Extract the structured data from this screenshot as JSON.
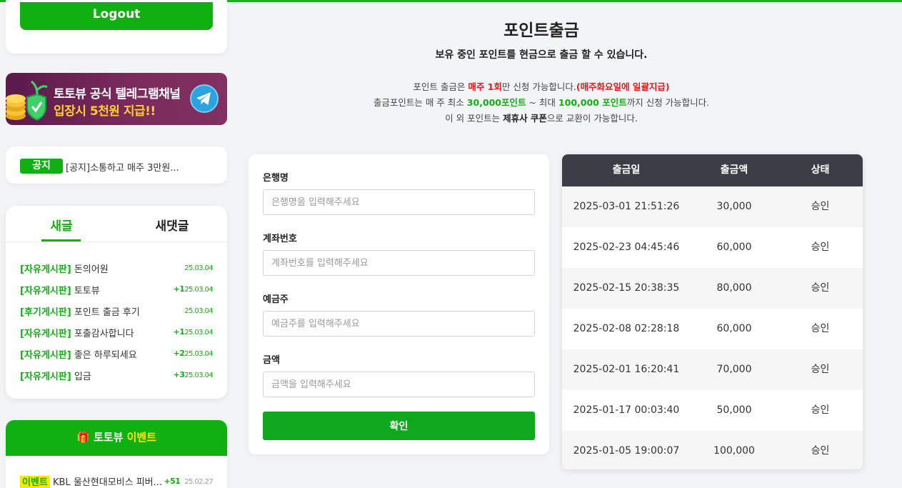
{
  "sidebar": {
    "logout_label": "Logout",
    "banner": {
      "line1": "토토뷰 공식 텔레그램채널",
      "line2": "입장시 5천원 지급!!"
    },
    "notice": {
      "badge": "공지",
      "text": "[공지]소통하고 매주 3만원..."
    },
    "posts": {
      "tabs": [
        "새글",
        "새댓글"
      ],
      "items": [
        {
          "board": "[자유게시판]",
          "title": "돈의어원",
          "count": "",
          "date": "25.03.04"
        },
        {
          "board": "[자유게시판]",
          "title": "토토뷰",
          "count": "+1",
          "date": "25.03.04"
        },
        {
          "board": "[후기게시판]",
          "title": "포인트 출금 후기",
          "count": "",
          "date": "25.03.04"
        },
        {
          "board": "[자유게시판]",
          "title": "포출감사합니다",
          "count": "+1",
          "date": "25.03.04"
        },
        {
          "board": "[자유게시판]",
          "title": "좋은 하루되세요",
          "count": "+2",
          "date": "25.03.04"
        },
        {
          "board": "[자유게시판]",
          "title": "입금",
          "count": "+3",
          "date": "25.03.04"
        }
      ]
    },
    "event": {
      "title_a": "토토뷰",
      "title_b": "이벤트",
      "items": [
        {
          "badge": "이벤트",
          "title": "KBL 울산현대모비스 피버...",
          "count": "+51",
          "date": "25.02.27"
        }
      ]
    }
  },
  "main": {
    "title": "포인트출금",
    "subtitle": "보유 중인 포인트를 현금으로 출금 할 수 있습니다.",
    "info1": {
      "a": "포인트 출금은 ",
      "b": "매주 1회",
      "c": "만 신청 가능합니다.",
      "d": "(매주화요일에 일괄지급)"
    },
    "info2": {
      "a": "출금포인트는 매 주 최소 ",
      "b": "30,000포인트",
      "c": " ~ 최대 ",
      "d": "100,000 포인트",
      "e": "까지 신청 가능합니다."
    },
    "info3": {
      "a": "이 외 포인트는 ",
      "b": "제휴사 쿠폰",
      "c": "으로 교환이 가능합니다."
    },
    "form": {
      "bank_label": "은행명",
      "bank_placeholder": "은행명을 입력해주세요",
      "account_label": "계좌번호",
      "account_placeholder": "계좌번호를 입력해주세요",
      "holder_label": "예금주",
      "holder_placeholder": "예금주를 입력해주세요",
      "amount_label": "금액",
      "amount_placeholder": "금액을 입력해주세요",
      "confirm_label": "확인"
    },
    "table": {
      "headers": [
        "출금일",
        "출금액",
        "상태"
      ],
      "rows": [
        {
          "date": "2025-03-01 21:51:26",
          "amount": "30,000",
          "status": "승인"
        },
        {
          "date": "2025-02-23 04:45:46",
          "amount": "60,000",
          "status": "승인"
        },
        {
          "date": "2025-02-15 20:38:35",
          "amount": "80,000",
          "status": "승인"
        },
        {
          "date": "2025-02-08 02:28:18",
          "amount": "60,000",
          "status": "승인"
        },
        {
          "date": "2025-02-01 16:20:41",
          "amount": "70,000",
          "status": "승인"
        },
        {
          "date": "2025-01-17 00:03:40",
          "amount": "50,000",
          "status": "승인"
        },
        {
          "date": "2025-01-05 19:00:07",
          "amount": "100,000",
          "status": "승인"
        }
      ]
    }
  },
  "colors": {
    "accent_green": "#10b010",
    "highlight_red": "#e21a1a",
    "table_header": "#3b3e46",
    "event_badge": "#ffe500"
  }
}
